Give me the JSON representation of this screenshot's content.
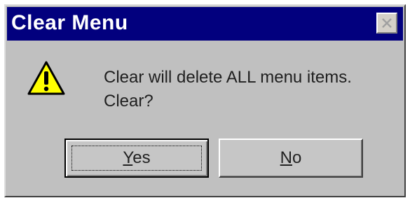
{
  "window": {
    "title": "Clear Menu",
    "close_icon": "close-icon"
  },
  "message": {
    "icon": "warning-icon",
    "line1": "Clear will delete ALL menu items.",
    "line2": "Clear?"
  },
  "buttons": {
    "yes_label": "Yes",
    "no_label": "No"
  },
  "colors": {
    "titlebar": "#02007e",
    "dialog_bg": "#c0c0c0",
    "warning_fill": "#ffff00"
  }
}
